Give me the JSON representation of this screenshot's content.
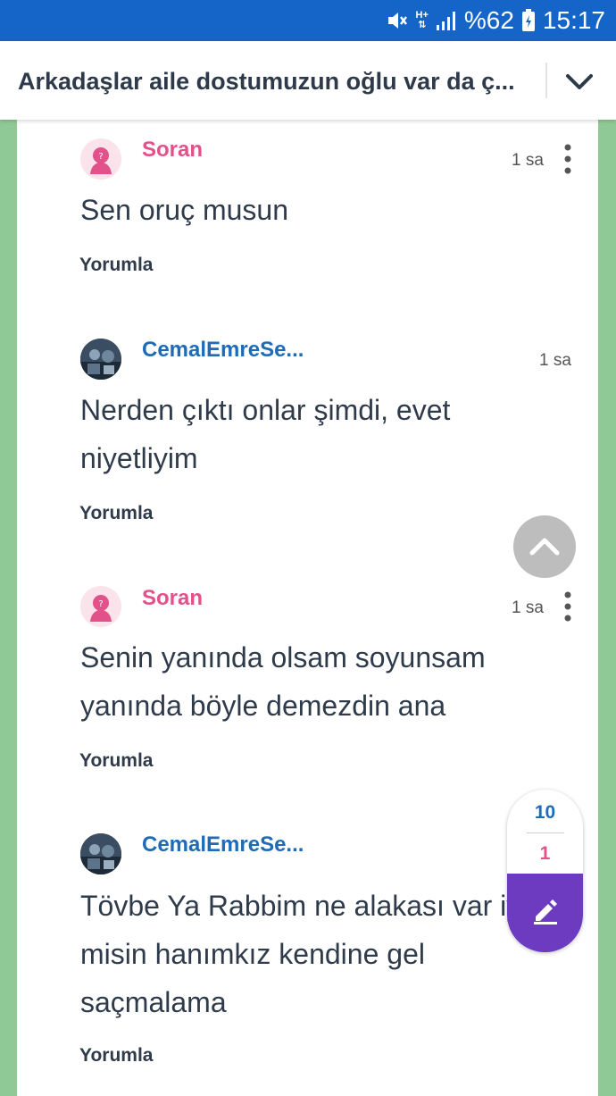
{
  "status_bar": {
    "battery": "%62",
    "time": "15:17",
    "network": "H+"
  },
  "header": {
    "title": "Arkadaşlar aile dostumuzun oğlu var da ç..."
  },
  "comments": [
    {
      "user": "Soran",
      "time": "1 sa",
      "lines": [
        "Sen oruç musun"
      ],
      "reply": "Yorumla"
    },
    {
      "user": "CemalEmreSe...",
      "time": "1 sa",
      "lines": [
        "Nerden çıktı onlar şimdi, evet",
        "niyetliyim"
      ],
      "reply": "Yorumla"
    },
    {
      "user": "Soran",
      "time": "1 sa",
      "lines": [
        "Senin yanında olsam soyunsam",
        "yanında böyle demezdin ana"
      ],
      "reply": "Yorumla"
    },
    {
      "user": "CemalEmreSe...",
      "time": "",
      "lines": [
        "Tövbe Ya Rabbim ne alakası var iyi",
        "misin hanımkız kendine gel",
        "saçmalama"
      ],
      "reply": "Yorumla"
    }
  ],
  "votes": {
    "up": "10",
    "down": "1"
  },
  "colors": {
    "status_bar": "#1565c8",
    "page_bg": "#8fc995",
    "soran": "#e2518a",
    "cemal": "#1e6bb8",
    "compose": "#6c3bbf"
  },
  "icons": [
    "mute-icon",
    "network-icon",
    "signal-icon",
    "battery-icon",
    "chevron-down-icon",
    "more-vertical-icon",
    "chevron-up-icon",
    "edit-pencil-icon",
    "anonymous-avatar-icon"
  ]
}
